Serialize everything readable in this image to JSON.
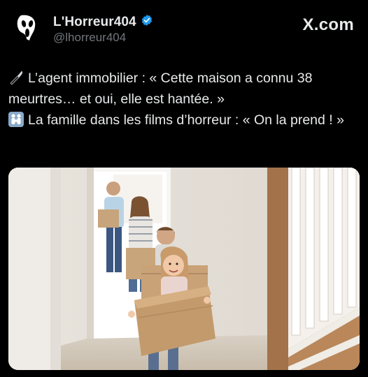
{
  "author": {
    "display_name": "L'Horreur404",
    "handle": "@lhorreur404",
    "verified": true,
    "avatar_icon": "ghostface-mask-icon",
    "verified_icon": "verified-badge-icon",
    "verified_color": "#1d9bf0"
  },
  "brand": {
    "label": "X.com"
  },
  "tweet": {
    "line1_emoji": "knife-emoji-icon",
    "line1_text": "L’agent immobilier : « Cette maison a connu 38 meurtres… et oui, elle est hantée. »",
    "line2_emoji": "family-emoji-icon",
    "line2_text": "La famille dans les films d’horreur : « On la prend ! »"
  },
  "media": {
    "description_icon": "family-moving-photo"
  },
  "colors": {
    "background": "#000000",
    "text": "#e7e9ea",
    "secondary_text": "#71767b"
  }
}
